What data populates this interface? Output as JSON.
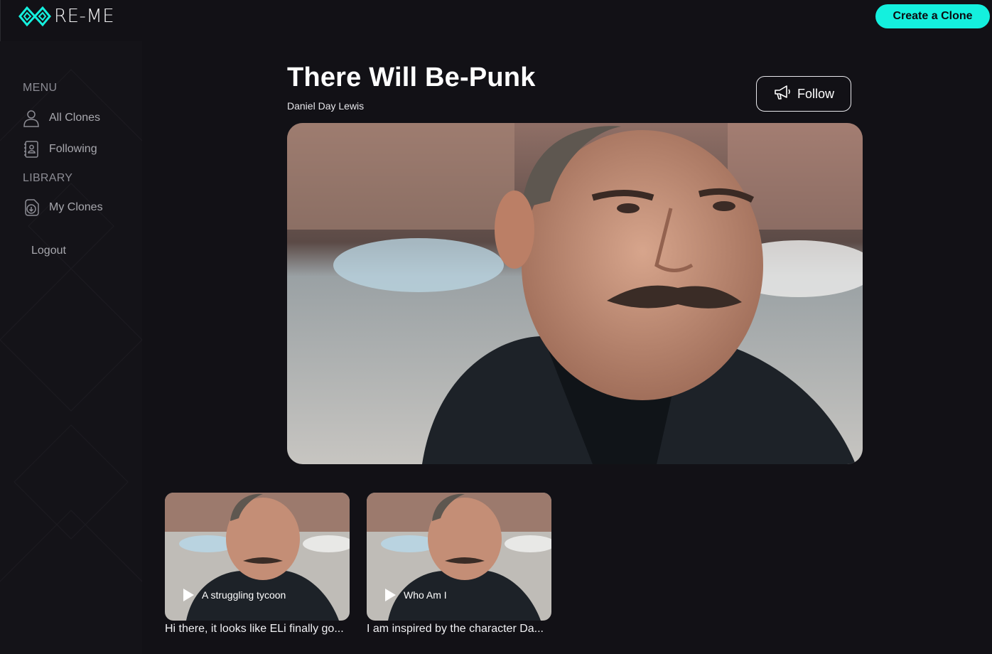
{
  "brand": {
    "name": "RE-ME",
    "accent": "#14f0de"
  },
  "header": {
    "create_label": "Create a Clone"
  },
  "sidebar": {
    "menu_label": "MENU",
    "items": [
      {
        "label": "All Clones",
        "icon": "user-icon"
      },
      {
        "label": "Following",
        "icon": "contacts-book-icon"
      }
    ],
    "library_label": "LIBRARY",
    "library_items": [
      {
        "label": "My Clones",
        "icon": "download-file-icon"
      }
    ],
    "logout_label": "Logout"
  },
  "main": {
    "title": "There Will Be-Punk",
    "subtitle": "Daniel Day Lewis",
    "follow_label": "Follow",
    "cards": [
      {
        "play_label": "A struggling tycoon",
        "caption": "Hi there, it looks like ELi finally go..."
      },
      {
        "play_label": "Who Am I",
        "caption": "I am inspired by the character Da..."
      }
    ]
  }
}
